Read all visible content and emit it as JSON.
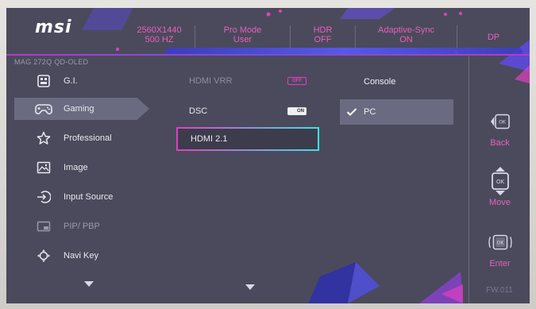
{
  "header": {
    "logo": "msi",
    "resolution": "2560X1440",
    "refresh": "500 HZ",
    "pro_mode_label": "Pro Mode",
    "pro_mode_value": "User",
    "hdr_label": "HDR",
    "hdr_value": "OFF",
    "adaptive_label": "Adaptive-Sync",
    "adaptive_value": "ON",
    "input": "DP"
  },
  "model": "MAG 272Q QD-OLED",
  "menu": {
    "items": [
      {
        "label": "G.I.",
        "icon": "gi-icon"
      },
      {
        "label": "Gaming",
        "icon": "gamepad-icon"
      },
      {
        "label": "Professional",
        "icon": "star-icon"
      },
      {
        "label": "Image",
        "icon": "image-icon"
      },
      {
        "label": "Input Source",
        "icon": "input-source-icon"
      },
      {
        "label": "PIP/ PBP",
        "icon": "pip-icon"
      },
      {
        "label": "Navi Key",
        "icon": "navi-key-icon"
      }
    ]
  },
  "settings": {
    "rows": [
      {
        "label": "HDMI VRR",
        "toggle": "OFF"
      },
      {
        "label": "DSC",
        "toggle": "ON"
      },
      {
        "label": "HDMI 2.1"
      }
    ]
  },
  "options": {
    "items": [
      {
        "label": "Console"
      },
      {
        "label": "PC",
        "selected": true
      }
    ]
  },
  "right_bar": {
    "back": "Back",
    "move": "Move",
    "enter": "Enter",
    "ok": "OK"
  },
  "firmware": "FW.011",
  "colors": {
    "accent_pink": "#e860b8",
    "osd_bg": "#4a4a5c",
    "highlight": "#6a6a80"
  }
}
